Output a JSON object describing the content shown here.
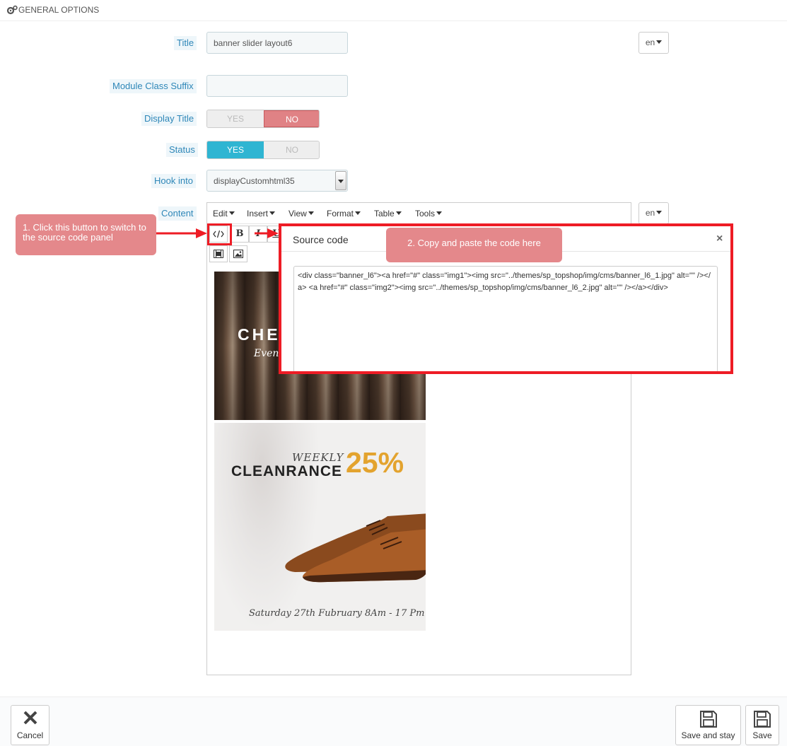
{
  "panel": {
    "heading": "GENERAL OPTIONS",
    "icon": "cogs-icon"
  },
  "form": {
    "title": {
      "label": "Title",
      "value": "banner slider layout6",
      "lang": "en"
    },
    "module_class_suffix": {
      "label": "Module Class Suffix",
      "value": ""
    },
    "display_title": {
      "label": "Display Title",
      "yes": "YES",
      "no": "NO",
      "selected": "NO"
    },
    "status": {
      "label": "Status",
      "yes": "YES",
      "no": "NO",
      "selected": "YES"
    },
    "hook_into": {
      "label": "Hook into",
      "value": "displayCustomhtml35"
    },
    "content": {
      "label": "Content",
      "lang": "en"
    }
  },
  "editor": {
    "menus": [
      "Edit",
      "Insert",
      "View",
      "Format",
      "Table",
      "Tools"
    ],
    "toolbar": {
      "bold": "B",
      "italic": "I",
      "underline": "U"
    },
    "banner1": {
      "headline": "CHE",
      "script": "Even"
    },
    "banner2": {
      "weekly": "WEEKLY",
      "headline": "CLEANRANCE",
      "percent": "25%",
      "date": "Saturday 27th Fubruary 8Am - 17 Pm"
    }
  },
  "annotations": {
    "step1": "1. Click this button to switch to the source code panel",
    "step2": "2. Copy and paste the code here"
  },
  "modal": {
    "title": "Source code",
    "close": "×",
    "code": "<div class=\"banner_l6\"><a href=\"#\" class=\"img1\"><img src=\"../themes/sp_topshop/img/cms/banner_l6_1.jpg\" alt=\"\" /></a> <a href=\"#\" class=\"img2\"><img src=\"../themes/sp_topshop/img/cms/banner_l6_2.jpg\" alt=\"\" /></a></div>"
  },
  "footer": {
    "cancel": "Cancel",
    "save_and_stay": "Save and stay",
    "save": "Save"
  },
  "colors": {
    "label_text": "#2e87b8",
    "no_active": "#e08285",
    "yes_active": "#2fb5d2",
    "callout": "#e4888b",
    "highlight": "#ee1c25",
    "banner_accent": "#e3a32e"
  }
}
